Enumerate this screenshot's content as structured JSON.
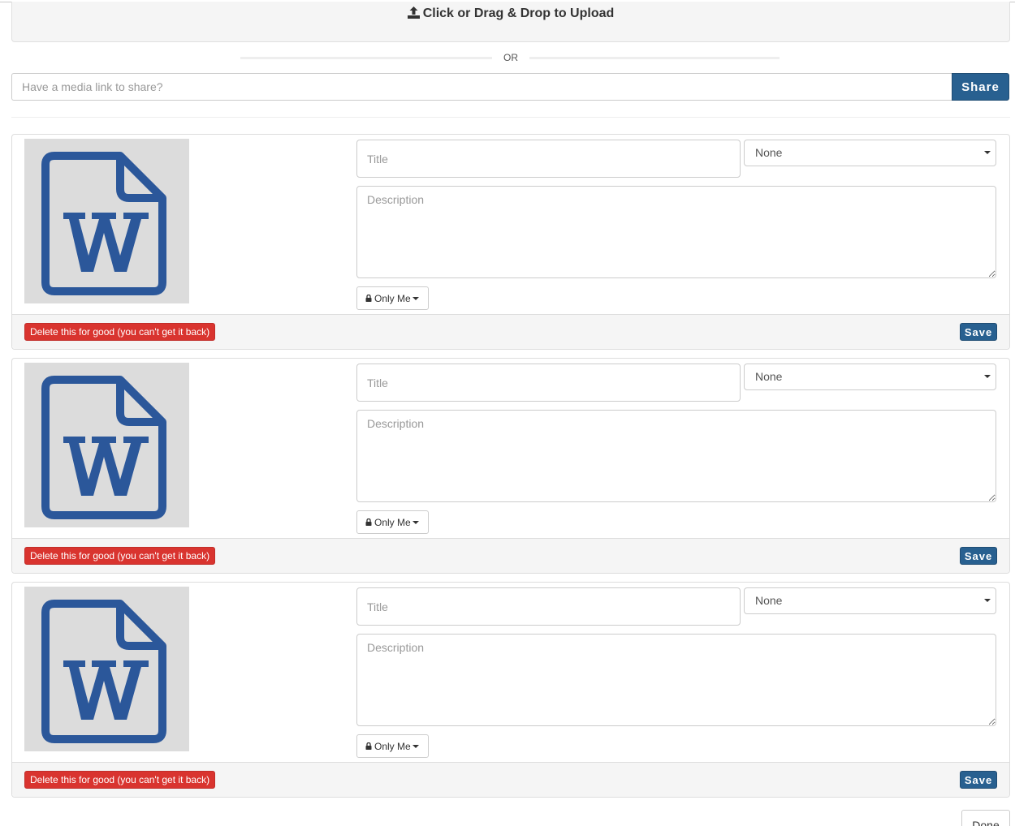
{
  "upload": {
    "label": "Click or Drag & Drop to Upload",
    "icon": "upload-icon"
  },
  "divider": {
    "or_label": "OR"
  },
  "media_link": {
    "placeholder": "Have a media link to share?",
    "share_label": "Share"
  },
  "colors": {
    "primary": "#286090",
    "danger": "#d9342f",
    "word_icon": "#2b579a",
    "thumb_bg": "#dcdcdc"
  },
  "items": [
    {
      "thumbnail_icon": "word-document-icon",
      "title_placeholder": "Title",
      "category_value": "None",
      "description_placeholder": "Description",
      "privacy_label": "Only Me",
      "delete_label": "Delete this for good (you can't get it back)",
      "save_label": "Save"
    },
    {
      "thumbnail_icon": "word-document-icon",
      "title_placeholder": "Title",
      "category_value": "None",
      "description_placeholder": "Description",
      "privacy_label": "Only Me",
      "delete_label": "Delete this for good (you can't get it back)",
      "save_label": "Save"
    },
    {
      "thumbnail_icon": "word-document-icon",
      "title_placeholder": "Title",
      "category_value": "None",
      "description_placeholder": "Description",
      "privacy_label": "Only Me",
      "delete_label": "Delete this for good (you can't get it back)",
      "save_label": "Save"
    }
  ],
  "done_label": "Done"
}
